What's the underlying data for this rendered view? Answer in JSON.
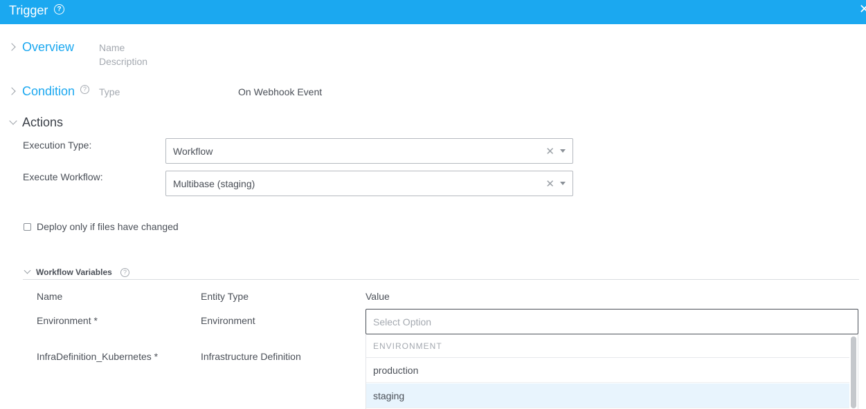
{
  "header": {
    "title": "Trigger",
    "help_icon": "question-circle-icon",
    "close_icon": "close-icon"
  },
  "overview": {
    "title": "Overview",
    "name_label": "Name",
    "description_label": "Description"
  },
  "condition": {
    "title": "Condition",
    "type_label": "Type",
    "type_value": "On Webhook Event"
  },
  "actions": {
    "title": "Actions",
    "execution_type_label": "Execution Type:",
    "execution_type_value": "Workflow",
    "execute_workflow_label": "Execute Workflow:",
    "execute_workflow_value": "Multibase (staging)",
    "deploy_checkbox_label": "Deploy only if files have changed",
    "deploy_checkbox_checked": false
  },
  "workflow_variables": {
    "title": "Workflow Variables",
    "columns": {
      "name": "Name",
      "entity_type": "Entity Type",
      "value": "Value"
    },
    "rows": [
      {
        "name": "Environment *",
        "entity_type": "Environment",
        "placeholder": "Select Option"
      },
      {
        "name": "InfraDefinition_Kubernetes *",
        "entity_type": "Infrastructure Definition"
      }
    ],
    "dropdown": {
      "group": "ENVIRONMENT",
      "options": [
        "production",
        "staging"
      ],
      "highlighted": "staging"
    }
  },
  "colors": {
    "accent": "#1ba8f0",
    "highlight": "#e8f4fd"
  }
}
